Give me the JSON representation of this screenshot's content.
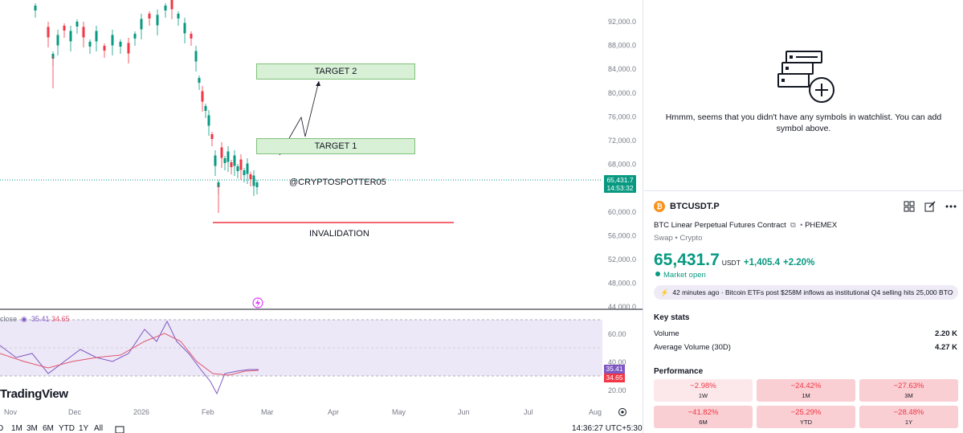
{
  "chart": {
    "price_axis": [
      "92,000.0",
      "88,000.0",
      "84,000.0",
      "80,000.0",
      "76,000.0",
      "72,000.0",
      "68,000.0",
      "64,000.0",
      "60,000.0",
      "56,000.0",
      "52,000.0",
      "48,000.0",
      "44,000.0"
    ],
    "rsi_axis": [
      "60.00",
      "40.00",
      "20.00"
    ],
    "time_axis": [
      "Nov",
      "Dec",
      "2026",
      "Feb",
      "Mar",
      "Apr",
      "May",
      "Jun",
      "Jul",
      "Aug"
    ],
    "last_price": "65,431.7",
    "countdown": "14:53:32",
    "target2_label": "TARGET 2",
    "target1_label": "TARGET 1",
    "watermark_text": "@CRYPTOSPOTTER05",
    "invalidation_label": "INVALIDATION",
    "rsi_header_prefix": "close",
    "rsi_value": "35.41",
    "rsi_ma_value": "34.65",
    "rsi_tag_value": "35.41",
    "rsi_ma_tag_value": "34.65",
    "logo_text": "TradingView",
    "ranges": [
      "D",
      "1M",
      "3M",
      "6M",
      "YTD",
      "1Y",
      "All"
    ],
    "clock": "14:36:27 UTC+5:30",
    "colors": {
      "up": "#089981",
      "down": "#f23645",
      "rsi": "#7e57c2",
      "rsi_ma": "#e0556e",
      "zone": "#d8f0d6"
    }
  },
  "watchlist": {
    "empty_message": "Hmmm, seems that you didn't have any symbols in watchlist. You can add symbol above.",
    "icon": "watchlist-add-icon"
  },
  "symbol": {
    "name": "BTCUSDT.P",
    "description": "BTC Linear Perpetual Futures Contract",
    "exchange": "PHEMEX",
    "subtype": "Swap • Crypto",
    "price": "65,431.7",
    "currency": "USDT",
    "change": "+1,405.4",
    "change_pct": "+2.20%",
    "market_status": "Market open",
    "news_time": "42 minutes ago",
    "news_headline": "Bitcoin ETFs post $258M inflows as institutional Q4 selling hits 25,000 BTC"
  },
  "key_stats": {
    "title": "Key stats",
    "volume_label": "Volume",
    "volume_value": "2.20 K",
    "avg_volume_label": "Average Volume (30D)",
    "avg_volume_value": "4.27 K"
  },
  "performance": {
    "title": "Performance",
    "items": [
      {
        "pct": "−2.98%",
        "label": "1W"
      },
      {
        "pct": "−24.42%",
        "label": "1M"
      },
      {
        "pct": "−27.63%",
        "label": "3M"
      },
      {
        "pct": "−41.82%",
        "label": "6M"
      },
      {
        "pct": "−25.29%",
        "label": "YTD"
      },
      {
        "pct": "−28.48%",
        "label": "1Y"
      }
    ]
  }
}
